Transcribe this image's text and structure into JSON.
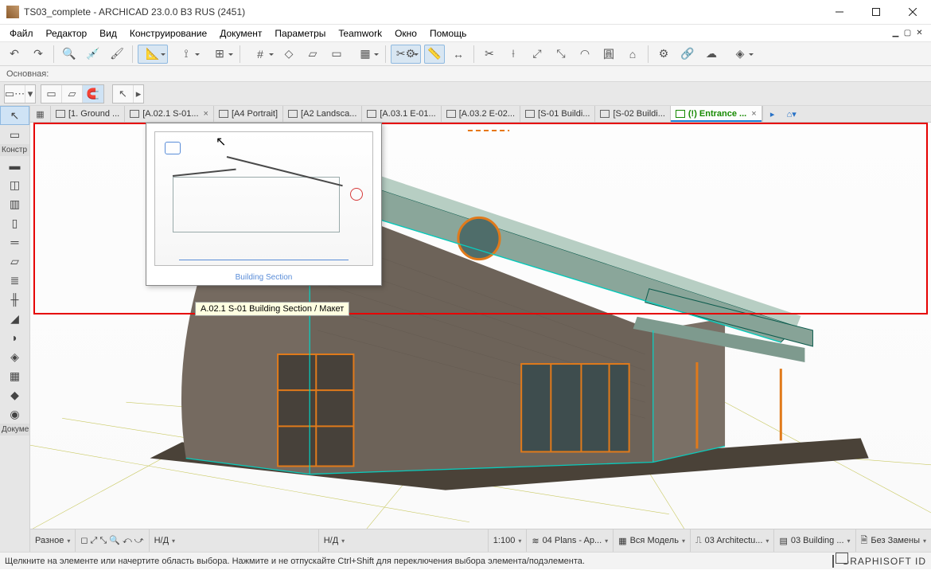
{
  "title": "TS03_complete - ARCHICAD 23.0.0 B3 RUS (2451)",
  "menu": [
    "Файл",
    "Редактор",
    "Вид",
    "Конструирование",
    "Документ",
    "Параметры",
    "Teamwork",
    "Окно",
    "Помощь"
  ],
  "layer_row": "Основная:",
  "left_head": "Констр",
  "left_doc": "Докуме",
  "tabs": [
    {
      "label": "[1. Ground ...",
      "close": false
    },
    {
      "label": "[A.02.1 S-01...",
      "close": true
    },
    {
      "label": "[A4 Portrait]",
      "close": false
    },
    {
      "label": "[A2 Landsca...",
      "close": false
    },
    {
      "label": "[A.03.1 E-01...",
      "close": false
    },
    {
      "label": "[A.03.2 E-02...",
      "close": false
    },
    {
      "label": "[S-01 Buildi...",
      "close": false
    },
    {
      "label": "[S-02 Buildi...",
      "close": false
    },
    {
      "label": "(!) Entrance ...",
      "close": true,
      "active": true
    }
  ],
  "preview_caption": "Building Section",
  "tooltip": "A.02.1 S-01 Building Section / Макет",
  "botbar": {
    "diff": "Разное",
    "nd1": "Н/Д",
    "nd2": "Н/Д",
    "scale": "1:100",
    "layers": "04 Plans - Ap...",
    "model": "Вся Модель",
    "arch": "03 Architectu...",
    "bldg": "03 Building ...",
    "repl": "Без Замены"
  },
  "status": "Щелкните на элементе или начертите область выбора. Нажмите и не отпускайте Ctrl+Shift для переключения выбора элемента/подэлемента.",
  "brand": "GRAPHISOFT ID"
}
